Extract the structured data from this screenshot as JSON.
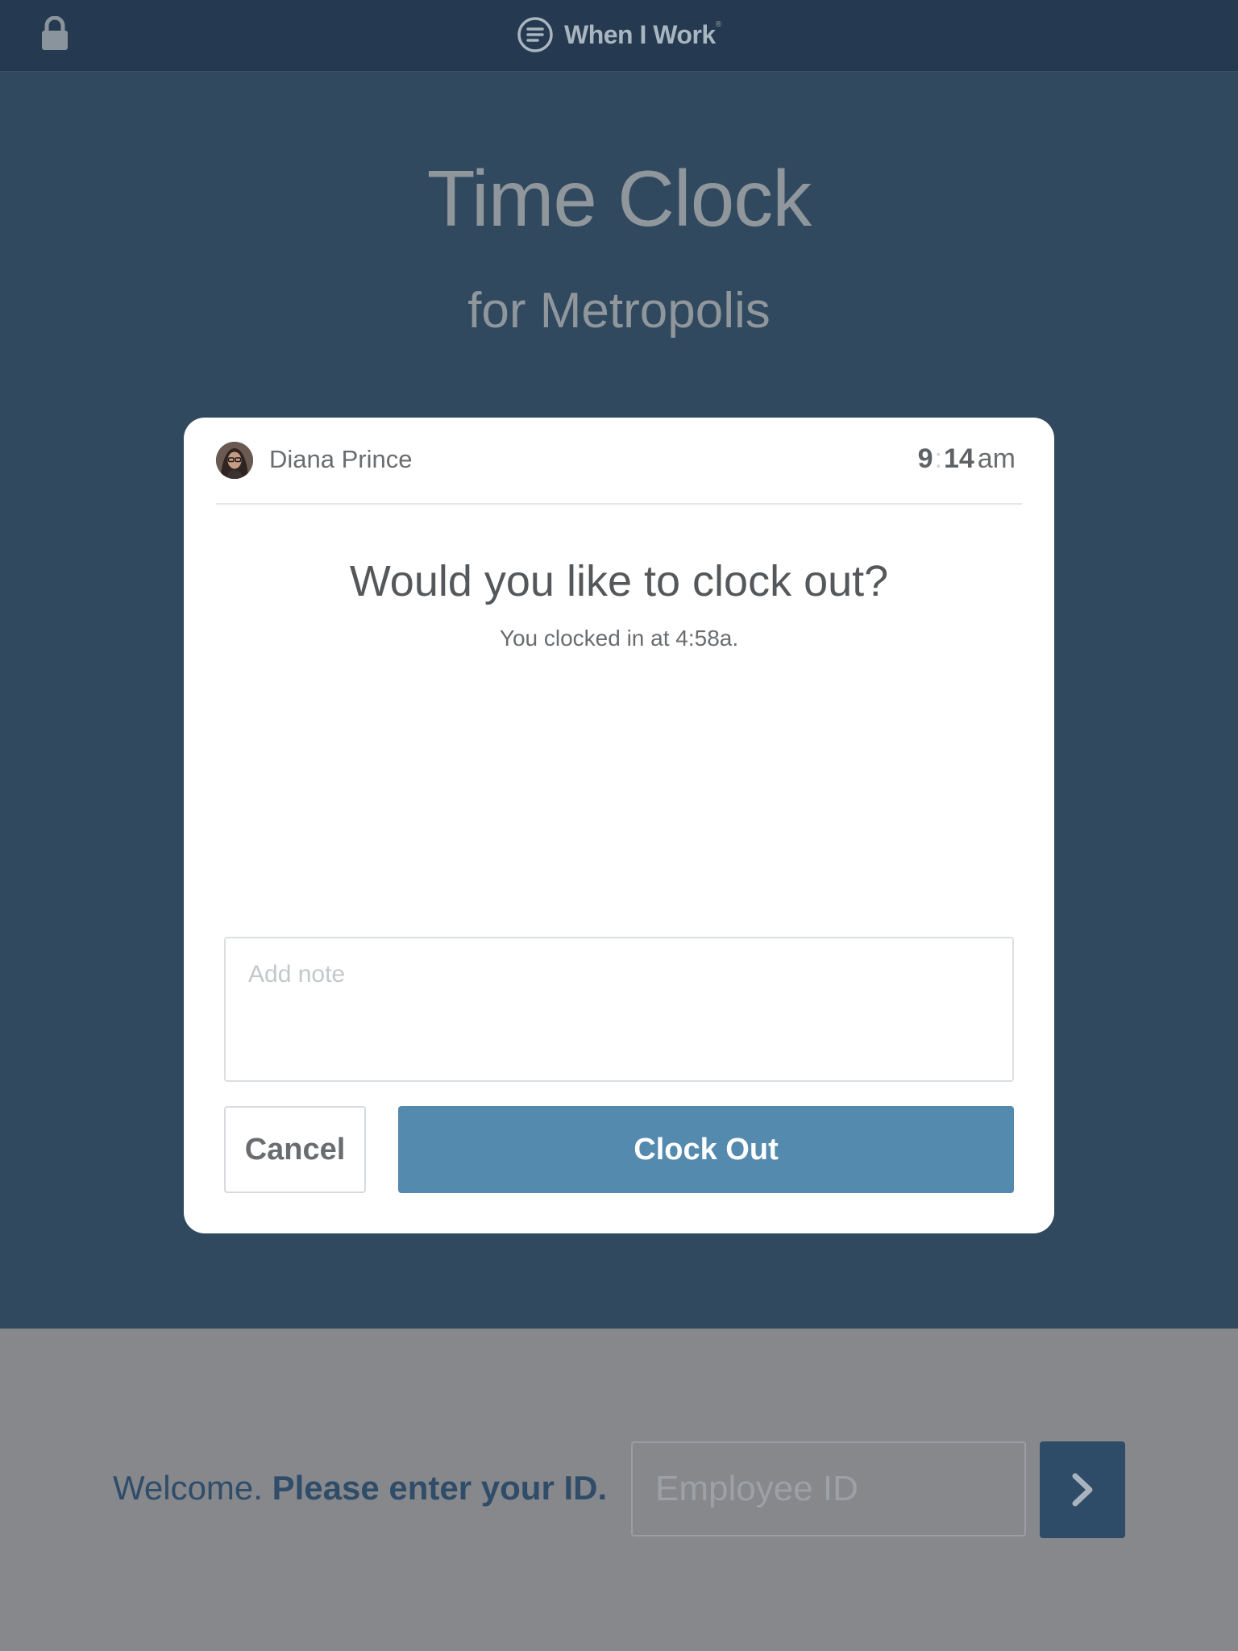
{
  "header": {
    "brand_name": "When I Work",
    "brand_mark": "®"
  },
  "hero": {
    "title": "Time Clock",
    "subtitle": "for Metropolis"
  },
  "modal": {
    "user_name": "Diana Prince",
    "time_hour": "9",
    "time_minute": "14",
    "time_ampm": "am",
    "question": "Would you like to clock out?",
    "clocked_in_text": "You clocked in at 4:58a.",
    "note_placeholder": "Add note",
    "cancel_label": "Cancel",
    "clockout_label": "Clock Out"
  },
  "welcome": {
    "greeting": "Welcome.",
    "instruction": "Please enter your ID.",
    "employee_id_placeholder": "Employee ID"
  },
  "icons": {
    "lock": "lock-icon",
    "logo": "when-i-work-logo-icon",
    "submit": "chevron-right-icon"
  },
  "colors": {
    "page_bg": "#31495e",
    "topbar_bg": "#253a50",
    "accent_button": "#558aaf",
    "submit_button": "#2e4b68",
    "welcome_bar": "#86888c"
  }
}
